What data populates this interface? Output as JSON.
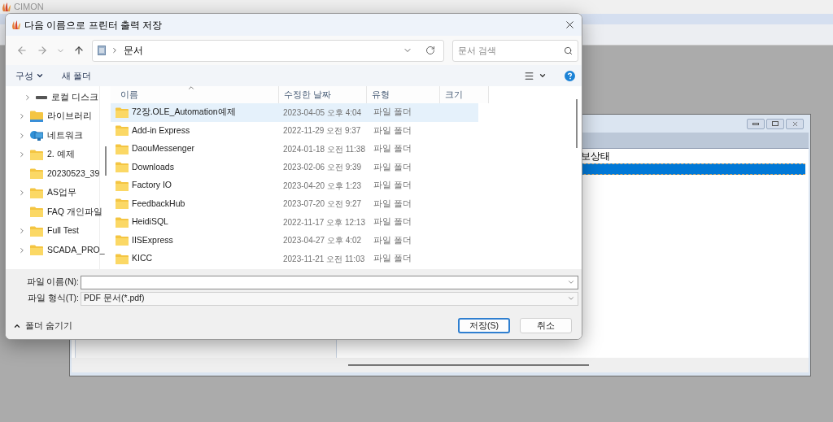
{
  "app": {
    "title": "CIMON"
  },
  "background_window": {
    "header_text": "보상태",
    "rows": [
      {
        "selected": true
      }
    ]
  },
  "dialog": {
    "title": "다음 이름으로 프린터 출력 저장",
    "address": {
      "path": "문서"
    },
    "search": {
      "placeholder": "문서 검색"
    },
    "toolbar": {
      "organize": "구성",
      "new_folder": "새 폴더"
    },
    "nav_tree": [
      {
        "label": "로컬 디스크",
        "kind": "drive",
        "expandable": true
      },
      {
        "label": "라이브러리",
        "kind": "library",
        "expandable": true
      },
      {
        "label": "네트워크",
        "kind": "network",
        "expandable": true
      },
      {
        "label": "2. 예제",
        "kind": "folder",
        "expandable": true
      },
      {
        "label": "20230523_39",
        "kind": "folder",
        "expandable": false
      },
      {
        "label": "AS업무",
        "kind": "folder",
        "expandable": true
      },
      {
        "label": "FAQ 개인파일",
        "kind": "folder",
        "expandable": false
      },
      {
        "label": "Full Test",
        "kind": "folder",
        "expandable": true
      },
      {
        "label": "SCADA_PRO_",
        "kind": "folder",
        "expandable": true
      }
    ],
    "columns": [
      "이름",
      "수정한 날짜",
      "유형",
      "크기"
    ],
    "files": [
      {
        "name": "72장.OLE_Automation예제",
        "modified": "2023-04-05 오후 4:04",
        "type": "파일 폴더",
        "selected": true
      },
      {
        "name": "Add-in Express",
        "modified": "2022-11-29 오전 9:37",
        "type": "파일 폴더",
        "selected": false
      },
      {
        "name": "DaouMessenger",
        "modified": "2024-01-18 오전 11:38",
        "type": "파일 폴더",
        "selected": false
      },
      {
        "name": "Downloads",
        "modified": "2023-02-06 오전 9:39",
        "type": "파일 폴더",
        "selected": false
      },
      {
        "name": "Factory IO",
        "modified": "2023-04-20 오후 1:23",
        "type": "파일 폴더",
        "selected": false
      },
      {
        "name": "FeedbackHub",
        "modified": "2023-07-20 오전 9:27",
        "type": "파일 폴더",
        "selected": false
      },
      {
        "name": "HeidiSQL",
        "modified": "2022-11-17 오후 12:13",
        "type": "파일 폴더",
        "selected": false
      },
      {
        "name": "IISExpress",
        "modified": "2023-04-27 오후 4:02",
        "type": "파일 폴더",
        "selected": false
      },
      {
        "name": "KICC",
        "modified": "2023-11-21 오전 11:03",
        "type": "파일 폴더",
        "selected": false
      }
    ],
    "file_name": {
      "label": "파일 이름(N):"
    },
    "file_type": {
      "label": "파일 형식(T):",
      "value": "PDF 문서(*.pdf)"
    },
    "hide_folders": "폴더 숨기기",
    "buttons": [
      {
        "label": "저장(S)",
        "primary": true
      },
      {
        "label": "취소",
        "primary": false
      }
    ]
  }
}
